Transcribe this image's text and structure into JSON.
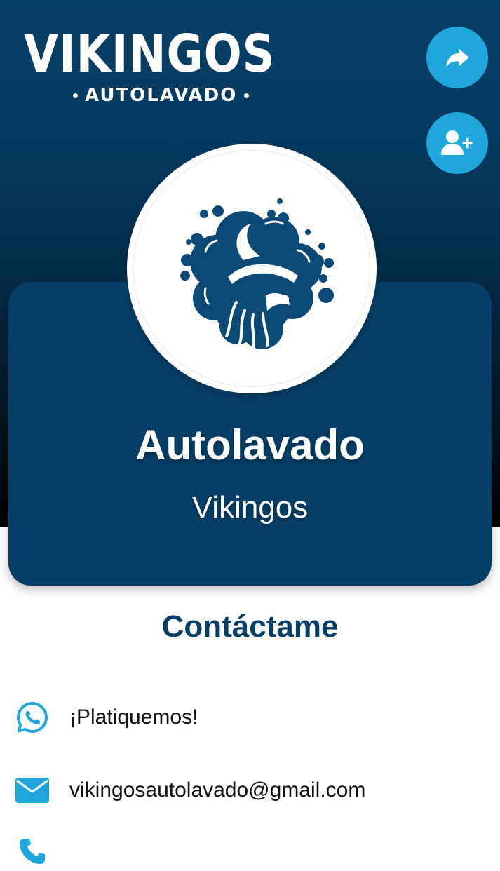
{
  "logo": {
    "title": "VIKINGOS",
    "subtitle": "AUTOLAVADO"
  },
  "actions": {
    "share_icon": "share-arrow-icon",
    "add_contact_icon": "add-contact-icon"
  },
  "profile": {
    "title": "Autolavado",
    "subtitle": "Vikingos"
  },
  "contact": {
    "heading": "Contáctame",
    "items": [
      {
        "icon": "whatsapp-icon",
        "label": "¡Platiquemos!"
      },
      {
        "icon": "email-icon",
        "label": "vikingosautolavado@gmail.com"
      }
    ]
  },
  "colors": {
    "brand_dark": "#053f68",
    "accent": "#1fa7dc",
    "background": "#ffffff"
  }
}
